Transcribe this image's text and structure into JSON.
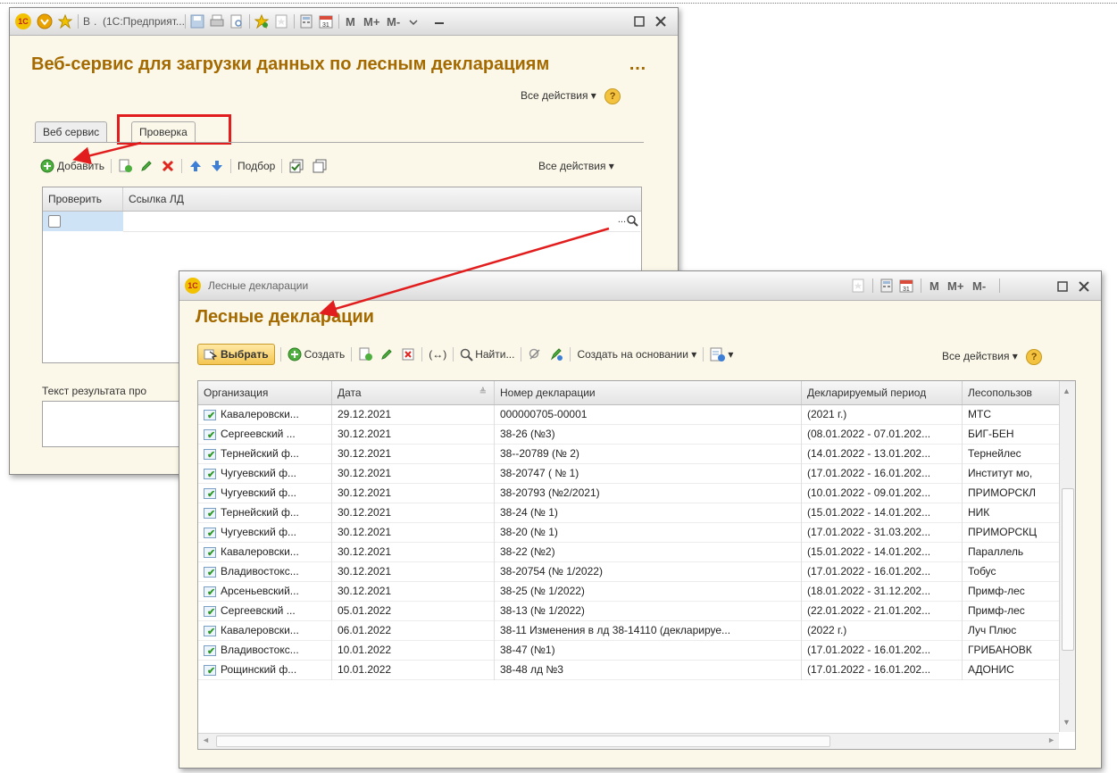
{
  "colors": {
    "accent": "#a46a00",
    "highlight_red": "#e11d1d",
    "selected_button": "#f4c652"
  },
  "win1": {
    "title_letter": "В",
    "title_rest": "(1С:Предприят...",
    "form_title": "Веб-сервис для загрузки данных по лесным декларациям",
    "all_actions": "Все действия",
    "help": "?",
    "tabs": [
      {
        "label": "Веб сервис"
      },
      {
        "label": "Проверка"
      }
    ],
    "toolbar": {
      "add": "Добавить",
      "pick": "Подбор",
      "all_actions": "Все действия"
    },
    "grid": {
      "col_check": "Проверить",
      "col_link": "Ссылка ЛД",
      "dots": "..."
    },
    "result_label": "Текст результата про",
    "m_buttons": [
      "M",
      "M+",
      "M-"
    ]
  },
  "win2": {
    "title": "Лесные декларации",
    "form_title": "Лесные декларации",
    "m_buttons": [
      "M",
      "M+",
      "M-"
    ],
    "toolbar": {
      "select": "Выбрать",
      "create": "Создать",
      "find": "Найти...",
      "create_based": "Создать на основании",
      "all_actions": "Все действия",
      "help": "?",
      "swap": "(↔)"
    },
    "columns": [
      "Организация",
      "Дата",
      "Номер декларации",
      "Декларируемый период",
      "Лесопользов"
    ],
    "rows": [
      [
        "Кавалеровски...",
        "29.12.2021",
        "000000705-00001",
        "(2021 г.)",
        "МТС"
      ],
      [
        "Сергеевский ...",
        "30.12.2021",
        "38-26 (№3)",
        "(08.01.2022 - 07.01.202...",
        "БИГ-БЕН"
      ],
      [
        "Тернейский ф...",
        "30.12.2021",
        "38--20789 (№ 2)",
        "(14.01.2022 - 13.01.202...",
        "Тернейлес"
      ],
      [
        "Чугуевский ф...",
        "30.12.2021",
        "38-20747 ( № 1)",
        "(17.01.2022 - 16.01.202...",
        "Институт мо,"
      ],
      [
        "Чугуевский ф...",
        "30.12.2021",
        "38-20793 (№2/2021)",
        "(10.01.2022 - 09.01.202...",
        "ПРИМОРСКЛ"
      ],
      [
        "Тернейский ф...",
        "30.12.2021",
        "38-24 (№ 1)",
        "(15.01.2022 - 14.01.202...",
        "НИК"
      ],
      [
        "Чугуевский ф...",
        "30.12.2021",
        "38-20 (№ 1)",
        "(17.01.2022 - 31.03.202...",
        "ПРИМОРСКЦ"
      ],
      [
        "Кавалеровски...",
        "30.12.2021",
        "38-22 (№2)",
        "(15.01.2022 - 14.01.202...",
        "Параллель"
      ],
      [
        "Владивостокс...",
        "30.12.2021",
        "38-20754 (№ 1/2022)",
        "(17.01.2022 - 16.01.202...",
        "Тобус"
      ],
      [
        "Арсеньевский...",
        "30.12.2021",
        "38-25 (№ 1/2022)",
        "(18.01.2022 - 31.12.202...",
        "Примф-лес"
      ],
      [
        "Сергеевский ...",
        "05.01.2022",
        "38-13 (№ 1/2022)",
        "(22.01.2022 - 21.01.202...",
        "Примф-лес"
      ],
      [
        "Кавалеровски...",
        "06.01.2022",
        "38-11 Изменения в лд 38-14110 (декларируе...",
        "(2022 г.)",
        "Луч Плюс"
      ],
      [
        "Владивостокс...",
        "10.01.2022",
        "38-47 (№1)",
        "(17.01.2022 - 16.01.202...",
        "ГРИБАНОВК"
      ],
      [
        "Рощинский ф...",
        "10.01.2022",
        "38-48 лд №3",
        "(17.01.2022 - 16.01.202...",
        "АДОНИС"
      ]
    ]
  }
}
